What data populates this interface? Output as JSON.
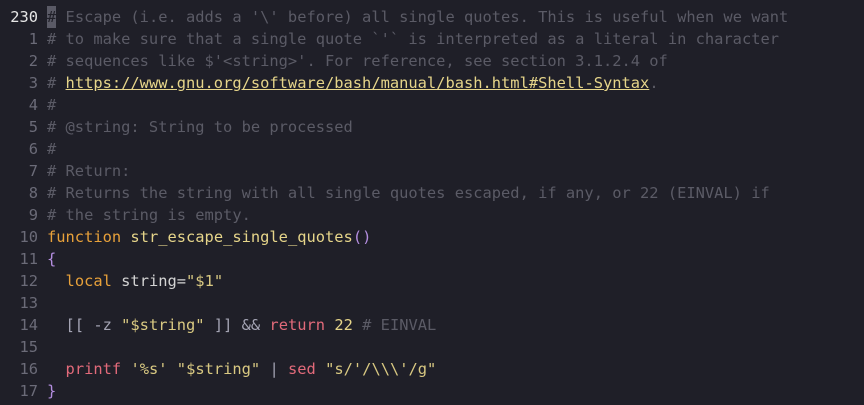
{
  "editor": {
    "current_line_number": "230",
    "lines": [
      {
        "num": "230",
        "current": true,
        "segments": [
          {
            "cls": "cursor-block",
            "text": "#"
          },
          {
            "cls": "c-comment",
            "text": " Escape (i.e. adds a '\\' before) all single quotes. This is useful when we want"
          }
        ]
      },
      {
        "num": "1",
        "segments": [
          {
            "cls": "c-comment",
            "text": "# to make sure that a single quote `'` is interpreted as a literal in character"
          }
        ]
      },
      {
        "num": "2",
        "segments": [
          {
            "cls": "c-comment",
            "text": "# sequences like $'<string>'. For reference, see section 3.1.2.4 of"
          }
        ]
      },
      {
        "num": "3",
        "segments": [
          {
            "cls": "c-comment",
            "text": "# "
          },
          {
            "cls": "c-link",
            "text": "https://www.gnu.org/software/bash/manual/bash.html#Shell-Syntax"
          },
          {
            "cls": "c-comment",
            "text": "."
          }
        ]
      },
      {
        "num": "4",
        "segments": [
          {
            "cls": "c-comment",
            "text": "#"
          }
        ]
      },
      {
        "num": "5",
        "segments": [
          {
            "cls": "c-comment",
            "text": "# @string: String to be processed"
          }
        ]
      },
      {
        "num": "6",
        "segments": [
          {
            "cls": "c-comment",
            "text": "#"
          }
        ]
      },
      {
        "num": "7",
        "segments": [
          {
            "cls": "c-comment",
            "text": "# Return:"
          }
        ]
      },
      {
        "num": "8",
        "segments": [
          {
            "cls": "c-comment",
            "text": "# Returns the string with all single quotes escaped, if any, or 22 (EINVAL) if"
          }
        ]
      },
      {
        "num": "9",
        "segments": [
          {
            "cls": "c-comment",
            "text": "# the string is empty."
          }
        ]
      },
      {
        "num": "10",
        "segments": [
          {
            "cls": "c-keyword",
            "text": "function"
          },
          {
            "cls": "c-plain",
            "text": " "
          },
          {
            "cls": "c-func",
            "text": "str_escape_single_quotes"
          },
          {
            "cls": "c-brace",
            "text": "()"
          }
        ]
      },
      {
        "num": "11",
        "segments": [
          {
            "cls": "c-brace",
            "text": "{"
          }
        ]
      },
      {
        "num": "12",
        "segments": [
          {
            "cls": "c-plain",
            "text": "  "
          },
          {
            "cls": "c-local",
            "text": "local"
          },
          {
            "cls": "c-plain",
            "text": " string="
          },
          {
            "cls": "c-string",
            "text": "\"$1\""
          }
        ]
      },
      {
        "num": "13",
        "segments": []
      },
      {
        "num": "14",
        "segments": [
          {
            "cls": "c-op",
            "text": "  [[ -z "
          },
          {
            "cls": "c-string",
            "text": "\"$string\""
          },
          {
            "cls": "c-op",
            "text": " ]] && "
          },
          {
            "cls": "c-return",
            "text": "return"
          },
          {
            "cls": "c-plain",
            "text": " "
          },
          {
            "cls": "c-number",
            "text": "22"
          },
          {
            "cls": "c-plain",
            "text": " "
          },
          {
            "cls": "c-comment",
            "text": "# EINVAL"
          }
        ]
      },
      {
        "num": "15",
        "segments": []
      },
      {
        "num": "16",
        "segments": [
          {
            "cls": "c-plain",
            "text": "  "
          },
          {
            "cls": "c-cmd",
            "text": "printf"
          },
          {
            "cls": "c-plain",
            "text": " "
          },
          {
            "cls": "c-string",
            "text": "'%s'"
          },
          {
            "cls": "c-plain",
            "text": " "
          },
          {
            "cls": "c-string",
            "text": "\"$string\""
          },
          {
            "cls": "c-op",
            "text": " | "
          },
          {
            "cls": "c-cmd",
            "text": "sed"
          },
          {
            "cls": "c-plain",
            "text": " "
          },
          {
            "cls": "c-string",
            "text": "\"s/'/\\\\\\'/g\""
          }
        ]
      },
      {
        "num": "17",
        "segments": [
          {
            "cls": "c-brace",
            "text": "}"
          }
        ]
      }
    ]
  },
  "colors": {
    "background": "#1f1f28",
    "comment": "#5b5b66",
    "keyword": "#e8a13a",
    "function": "#e6d58a",
    "string": "#d9c982",
    "control": "#e26a7a",
    "brace": "#b48ee0"
  }
}
